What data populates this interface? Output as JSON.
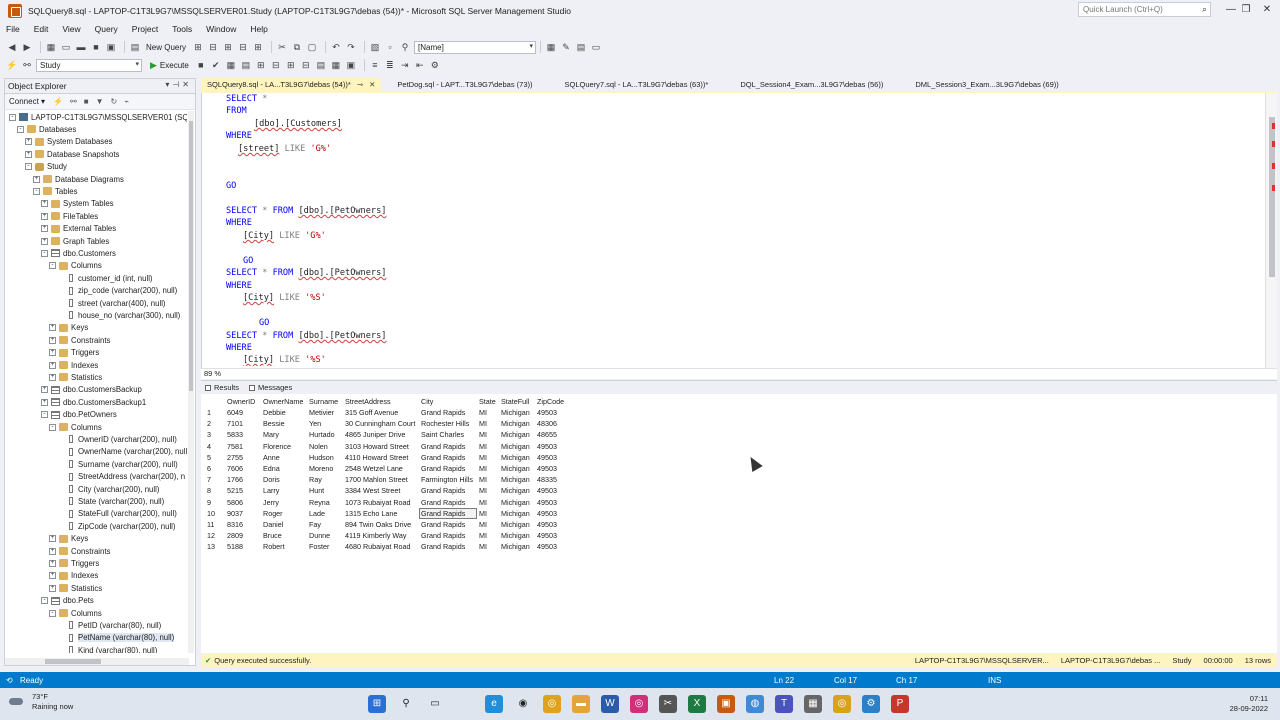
{
  "window": {
    "title": "SQLQuery8.sql - LAPTOP-C1T3L9G7\\MSSQLSERVER01.Study (LAPTOP-C1T3L9G7\\debas (54))* - Microsoft SQL Server Management Studio",
    "quick_launch_placeholder": "Quick Launch (Ctrl+Q)"
  },
  "menu": [
    "File",
    "Edit",
    "View",
    "Query",
    "Project",
    "Tools",
    "Window",
    "Help"
  ],
  "toolbar": {
    "new_query": "New Query",
    "name_combo": "[Name]",
    "database": "Study",
    "execute": "Execute"
  },
  "object_explorer": {
    "title": "Object Explorer",
    "connect": "Connect",
    "nodes": [
      "LAPTOP-C1T3L9G7\\MSSQLSERVER01 (SQL Se",
      "Databases",
      "System Databases",
      "Database Snapshots",
      "Study",
      "Database Diagrams",
      "Tables",
      "System Tables",
      "FileTables",
      "External Tables",
      "Graph Tables",
      "dbo.Customers",
      "Columns",
      "customer_id (int, null)",
      "zip_code (varchar(200), null)",
      "street (varchar(400), null)",
      "house_no (varchar(300), null)",
      "Keys",
      "Constraints",
      "Triggers",
      "Indexes",
      "Statistics",
      "dbo.CustomersBackup",
      "dbo.CustomersBackup1",
      "dbo.PetOwners",
      "Columns",
      "OwnerID (varchar(200), null)",
      "OwnerName (varchar(200), null",
      "Surname (varchar(200), null)",
      "StreetAddress (varchar(200), n",
      "City (varchar(200), null)",
      "State (varchar(200), null)",
      "StateFull (varchar(200), null)",
      "ZipCode (varchar(200), null)",
      "Keys",
      "Constraints",
      "Triggers",
      "Indexes",
      "Statistics",
      "dbo.Pets",
      "Columns",
      "PetID (varchar(80), null)",
      "PetName (varchar(80), null)",
      "Kind (varchar(80), null)"
    ]
  },
  "tabs": [
    "SQLQuery8.sql - LA...T3L9G7\\debas (54))*",
    "PetDog.sql - LAPT...T3L9G7\\debas (73))",
    "SQLQuery7.sql - LA...T3L9G7\\debas (63))*",
    "DQL_Session4_Exam...3L9G7\\debas (56))",
    "DML_Session3_Exam...3L9G7\\debas (69))"
  ],
  "code": {
    "l1_kw": "SELECT",
    "l1_rest": " *",
    "l2": "FROM",
    "l3": "[dbo].[Customers]",
    "l4": "WHERE",
    "l5_id": "[street]",
    "l5_like": " LIKE ",
    "l5_str": "'G%'",
    "go": "GO",
    "sel_a": "SELECT * FROM [dbo].[PetOwners]",
    "where": "WHERE",
    "city": "[City]",
    "like": " LIKE ",
    "str1": "'G%'",
    "str2": "'%S'",
    "str3": "'%S'"
  },
  "editor_zoom": "89 %",
  "results": {
    "tabs": [
      "Results",
      "Messages"
    ],
    "columns": [
      "OwnerID",
      "OwnerName",
      "Surname",
      "StreetAddress",
      "City",
      "State",
      "StateFull",
      "ZipCode"
    ],
    "rows": [
      [
        "1",
        "6049",
        "Debbie",
        "Metivier",
        "315 Goff Avenue",
        "Grand Rapids",
        "MI",
        "Michigan",
        "49503"
      ],
      [
        "2",
        "7101",
        "Bessie",
        "Yen",
        "30 Cunningham Court",
        "Rochester Hills",
        "MI",
        "Michigan",
        "48306"
      ],
      [
        "3",
        "5833",
        "Mary",
        "Hurtado",
        "4865 Juniper Drive",
        "Saint Charles",
        "MI",
        "Michigan",
        "48655"
      ],
      [
        "4",
        "7581",
        "Florence",
        "Nolen",
        "3103 Howard Street",
        "Grand Rapids",
        "MI",
        "Michigan",
        "49503"
      ],
      [
        "5",
        "2755",
        "Anne",
        "Hudson",
        "4110 Howard Street",
        "Grand Rapids",
        "MI",
        "Michigan",
        "49503"
      ],
      [
        "6",
        "7606",
        "Edna",
        "Moreno",
        "2548 Wetzel Lane",
        "Grand Rapids",
        "MI",
        "Michigan",
        "49503"
      ],
      [
        "7",
        "1766",
        "Doris",
        "Ray",
        "1700 Mahlon Street",
        "Farmington Hills",
        "MI",
        "Michigan",
        "48335"
      ],
      [
        "8",
        "5215",
        "Larry",
        "Hunt",
        "3384 West Street",
        "Grand Rapids",
        "MI",
        "Michigan",
        "49503"
      ],
      [
        "9",
        "5806",
        "Jerry",
        "Reyna",
        "1073 Rubaiyat Road",
        "Grand Rapids",
        "MI",
        "Michigan",
        "49503"
      ],
      [
        "10",
        "9037",
        "Roger",
        "Lade",
        "1315 Echo Lane",
        "Grand Rapids",
        "MI",
        "Michigan",
        "49503"
      ],
      [
        "11",
        "8316",
        "Daniel",
        "Fay",
        "894 Twin Oaks Drive",
        "Grand Rapids",
        "MI",
        "Michigan",
        "49503"
      ],
      [
        "12",
        "2809",
        "Bruce",
        "Dunne",
        "4119 Kimberly Way",
        "Grand Rapids",
        "MI",
        "Michigan",
        "49503"
      ],
      [
        "13",
        "5188",
        "Robert",
        "Foster",
        "4680 Rubaiyat Road",
        "Grand Rapids",
        "MI",
        "Michigan",
        "49503"
      ]
    ]
  },
  "query_status": {
    "message": "Query executed successfully.",
    "server": "LAPTOP-C1T3L9G7\\MSSQLSERVER...",
    "user": "LAPTOP-C1T3L9G7\\debas ...",
    "database": "Study",
    "elapsed": "00:00:00",
    "rows": "13 rows"
  },
  "statusbar": {
    "ready": "Ready",
    "ln": "Ln 22",
    "col": "Col 17",
    "ch": "Ch 17",
    "mode": "INS"
  },
  "taskbar": {
    "temp": "73°F",
    "weather": "Raining now",
    "time": "07:11",
    "date": "28-09-2022"
  }
}
